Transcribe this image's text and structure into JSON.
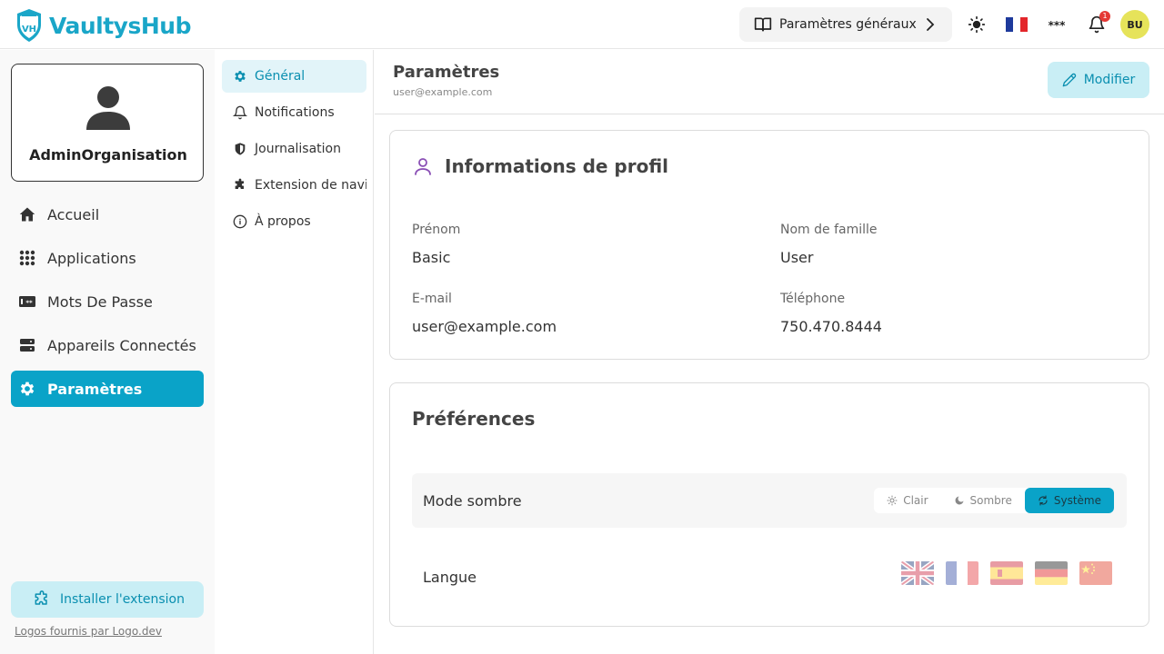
{
  "header": {
    "brand": "VaultysHub",
    "brand_badge": "VH",
    "general_settings_label": "Paramètres généraux",
    "notification_count": "1",
    "avatar_initials": "BU"
  },
  "sidebar": {
    "org_name": "AdminOrganisation",
    "items": [
      {
        "label": "Accueil",
        "icon": "home-icon"
      },
      {
        "label": "Applications",
        "icon": "grid-icon"
      },
      {
        "label": "Mots De Passe",
        "icon": "password-icon"
      },
      {
        "label": "Appareils Connectés",
        "icon": "server-icon"
      },
      {
        "label": "Paramètres",
        "icon": "gear-icon",
        "active": true
      }
    ],
    "install_label": "Installer l'extension",
    "logos_credit": "Logos fournis par Logo.dev"
  },
  "submenu": {
    "items": [
      {
        "label": "Général",
        "icon": "gear-icon",
        "active": true
      },
      {
        "label": "Notifications",
        "icon": "bell-icon"
      },
      {
        "label": "Journalisation",
        "icon": "shield-icon"
      },
      {
        "label": "Extension de navi",
        "icon": "puzzle-icon"
      },
      {
        "label": "À propos",
        "icon": "info-icon"
      }
    ]
  },
  "main": {
    "title": "Paramètres",
    "subtitle": "user@example.com",
    "modify_label": "Modifier",
    "profile": {
      "title": "Informations de profil",
      "first_name_label": "Prénom",
      "first_name": "Basic",
      "last_name_label": "Nom de famille",
      "last_name": "User",
      "email_label": "E-mail",
      "email": "user@example.com",
      "phone_label": "Téléphone",
      "phone": "750.470.8444"
    },
    "preferences": {
      "title": "Préférences",
      "dark_mode_label": "Mode sombre",
      "mode_options": [
        "Clair",
        "Sombre",
        "Système"
      ],
      "mode_selected": "Système",
      "language_label": "Langue",
      "languages": [
        "uk-flag",
        "fr-flag",
        "es-flag",
        "de-flag",
        "cn-flag"
      ]
    }
  },
  "colors": {
    "brand": "#1aa6c8",
    "accent": "#0aa3c8",
    "accent_light": "#c9eef5",
    "badge": "#e53935",
    "avatar": "#e6e35a"
  }
}
